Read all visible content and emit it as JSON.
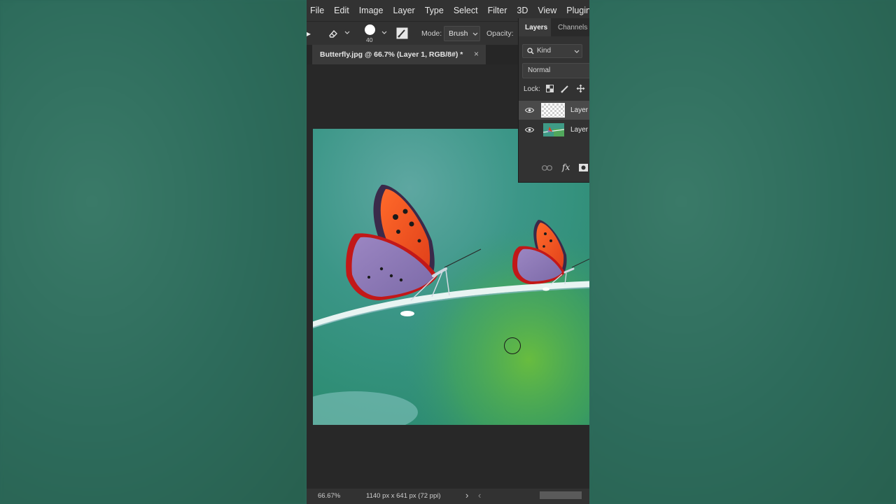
{
  "menu": [
    "File",
    "Edit",
    "Image",
    "Layer",
    "Type",
    "Select",
    "Filter",
    "3D",
    "View",
    "Plugins"
  ],
  "options_bar": {
    "brush_size": "40",
    "mode_label": "Mode:",
    "mode_value": "Brush",
    "opacity_label": "Opacity:"
  },
  "document_tab": {
    "title": "Butterfly.jpg @ 66.7% (Layer 1, RGB/8#) *",
    "close_glyph": "×"
  },
  "layers_panel": {
    "tabs": [
      "Layers",
      "Channels"
    ],
    "kind_label": "Kind",
    "blend_mode": "Normal",
    "lock_label": "Lock:",
    "layers": [
      {
        "name": "Layer",
        "visible": true,
        "thumbnail": "transparent"
      },
      {
        "name": "Layer",
        "visible": true,
        "thumbnail": "butterfly-image"
      }
    ],
    "footer_fx": "fx"
  },
  "status_bar": {
    "zoom": "66.67%",
    "doc_info": "1140 px x 641 px (72 ppi)",
    "arrow_right": "›",
    "arrow_left": "‹"
  },
  "colors": {
    "ui_dark": "#282828",
    "panel": "#323232",
    "backdrop_green": "#2e6a5c"
  }
}
